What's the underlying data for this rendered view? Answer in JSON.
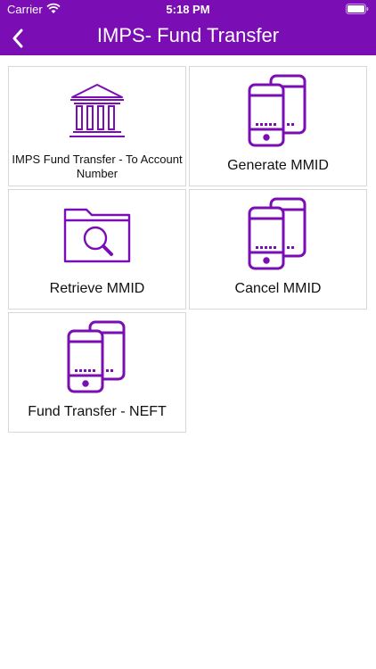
{
  "status_bar": {
    "carrier": "Carrier",
    "time": "5:18 PM"
  },
  "header": {
    "title": "IMPS- Fund Transfer",
    "back_icon": "chevron-left-icon",
    "background": "#7a0db3"
  },
  "accent_color": "#7a0db3",
  "tiles": [
    {
      "label": "IMPS Fund Transfer - To Account Number",
      "icon": "bank-icon"
    },
    {
      "label": "Generate MMID",
      "icon": "mobile-phones-icon"
    },
    {
      "label": "Retrieve MMID",
      "icon": "folder-search-icon"
    },
    {
      "label": "Cancel MMID",
      "icon": "mobile-phones-icon"
    },
    {
      "label": "Fund Transfer - NEFT",
      "icon": "mobile-phones-icon"
    }
  ]
}
